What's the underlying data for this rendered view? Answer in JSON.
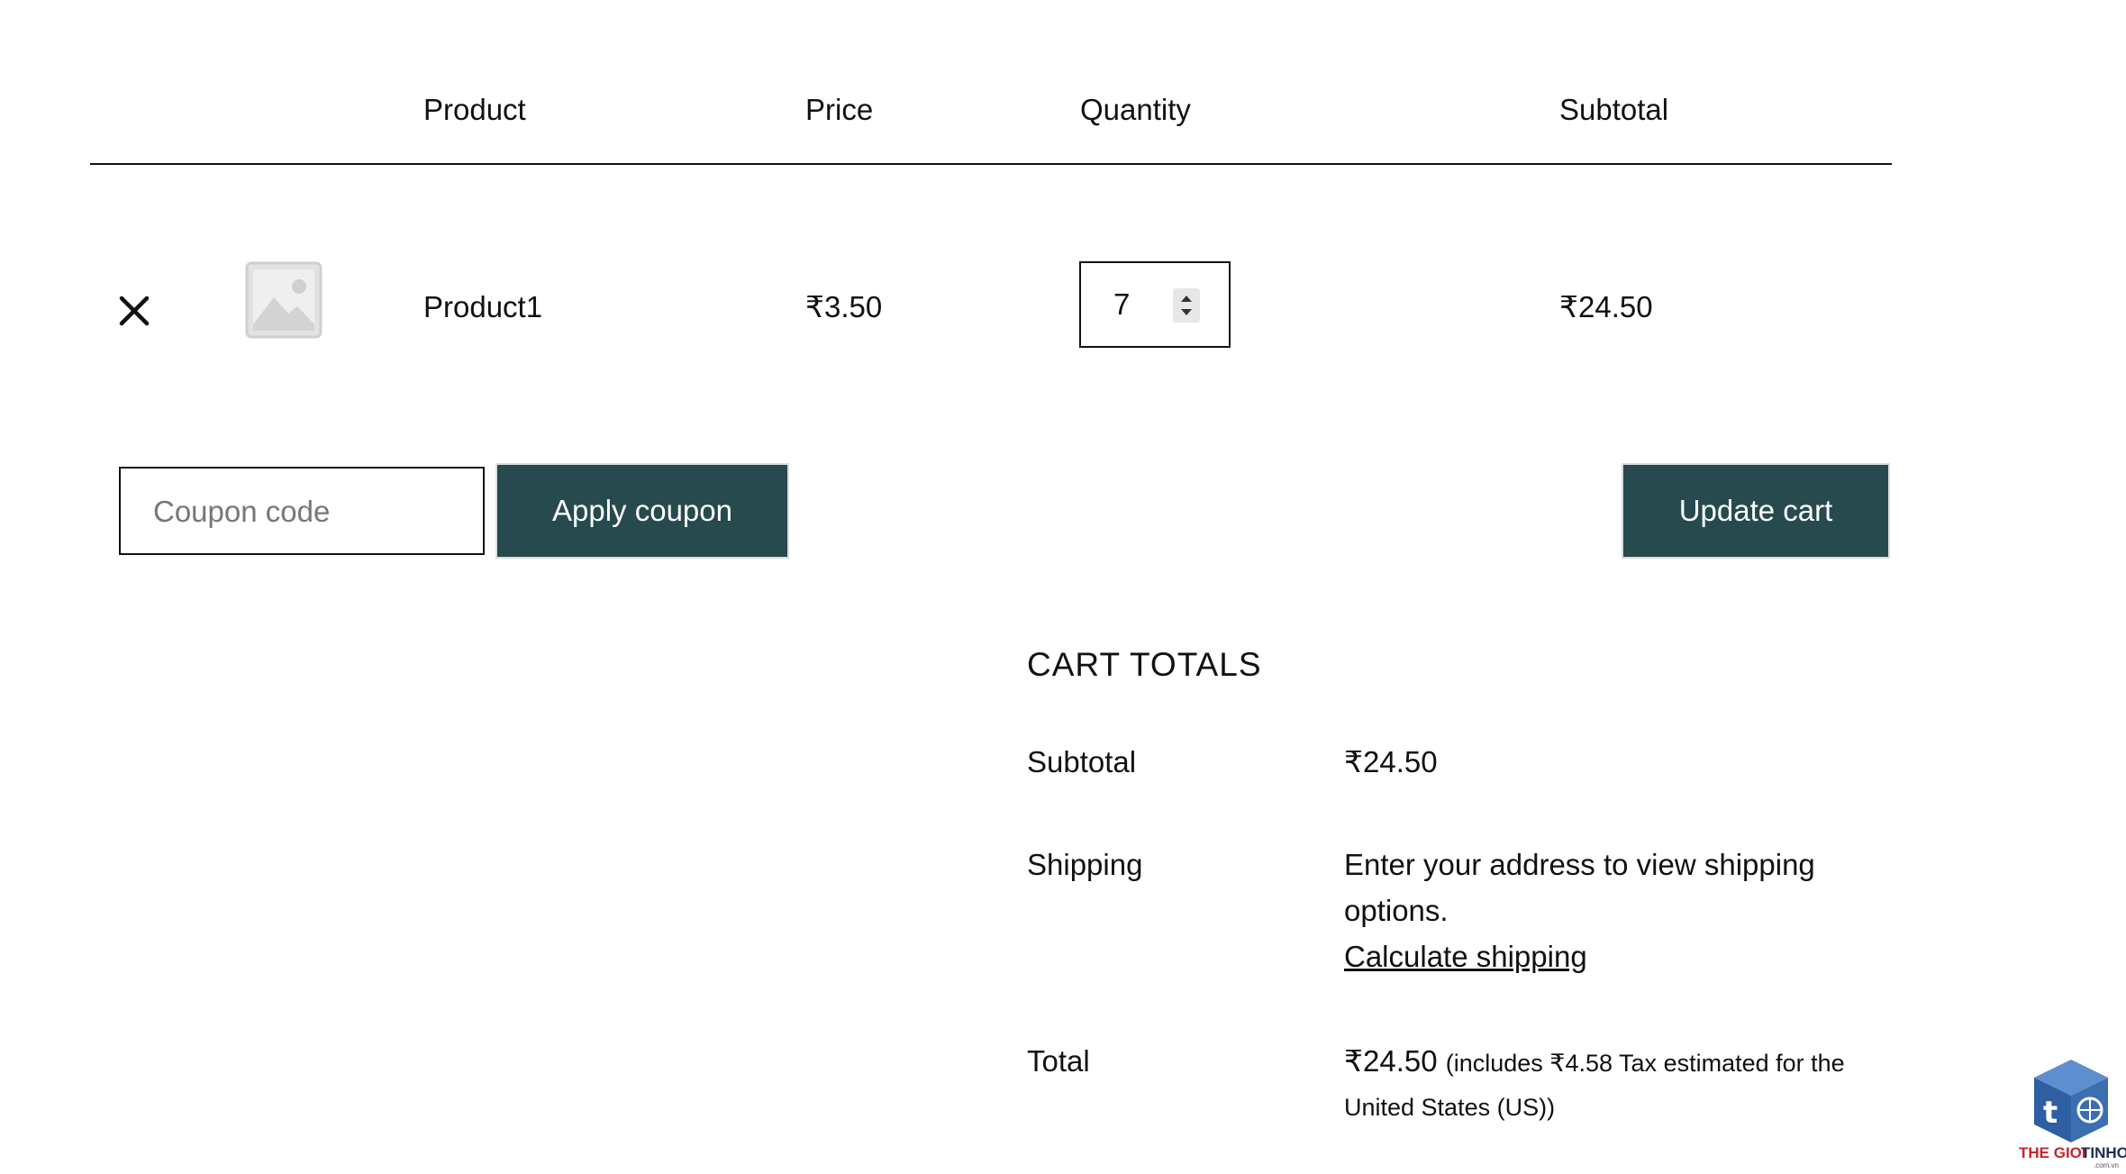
{
  "table": {
    "headers": [
      "Product",
      "Price",
      "Quantity",
      "Subtotal"
    ],
    "rows": [
      {
        "product_name": "Product1",
        "price": "₹3.50",
        "quantity": "7",
        "subtotal": "₹24.50"
      }
    ]
  },
  "coupon": {
    "placeholder": "Coupon code",
    "apply_label": "Apply coupon"
  },
  "update_label": "Update cart",
  "cart_totals": {
    "title": "CART TOTALS",
    "subtotal_label": "Subtotal",
    "subtotal_value": "₹24.50",
    "shipping_label": "Shipping",
    "shipping_text_line1": "Enter your address to view shipping",
    "shipping_text_line2": "options.",
    "calculate_shipping": "Calculate shipping",
    "total_label": "Total",
    "total_value": "₹24.50",
    "tax_note_line1": "(includes ₹4.58 Tax estimated for the",
    "tax_note_line2": "United States (US))"
  },
  "logo": {
    "text_red": "THE GIOI",
    "text_dark": "TINHOC",
    "domain": ".com.vn",
    "badge_letter": "t"
  },
  "colors": {
    "button_bg": "#264a4e",
    "button_text": "#ffffff",
    "placeholder_image": "#d9d9d9",
    "logo_blue": "#3b6fb0",
    "logo_red": "#c4262e"
  }
}
